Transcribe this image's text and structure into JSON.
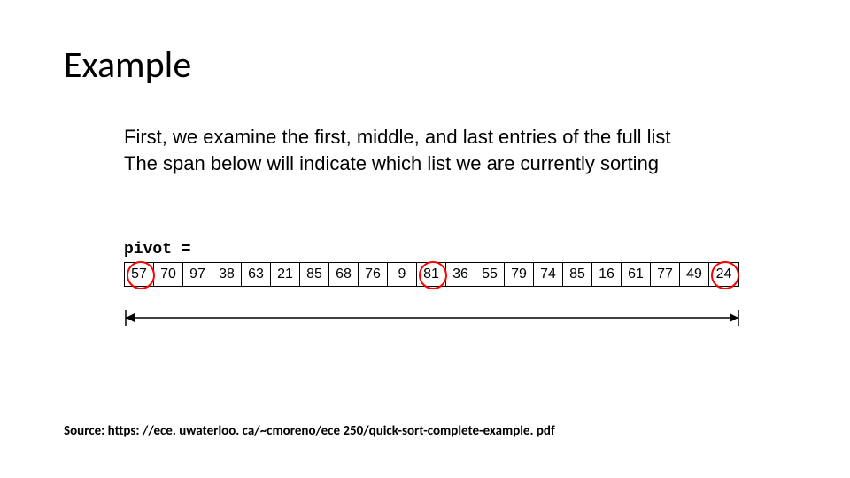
{
  "title": "Example",
  "body": {
    "line1": "First, we examine the first, middle, and last entries of the full list",
    "line2": "The span below will indicate which list we are currently sorting"
  },
  "pivot_label": "pivot =",
  "array": {
    "values": [
      57,
      70,
      97,
      38,
      63,
      21,
      85,
      68,
      76,
      9,
      81,
      36,
      55,
      79,
      74,
      85,
      16,
      61,
      77,
      49,
      24
    ],
    "circled_indices": [
      0,
      10,
      20
    ]
  },
  "span": {
    "start_index": 0,
    "end_index": 20
  },
  "source": "Source: https: //ece. uwaterloo. ca/~cmoreno/ece 250/quick-sort-complete-example. pdf",
  "chart_data": {
    "type": "table",
    "description": "Quicksort example array with median-of-three pivot candidates circled",
    "values": [
      57,
      70,
      97,
      38,
      63,
      21,
      85,
      68,
      76,
      9,
      81,
      36,
      55,
      79,
      74,
      85,
      16,
      61,
      77,
      49,
      24
    ],
    "highlighted_indices": [
      0,
      10,
      20
    ],
    "highlighted_values": [
      57,
      81,
      24
    ],
    "current_span": [
      0,
      20
    ]
  }
}
